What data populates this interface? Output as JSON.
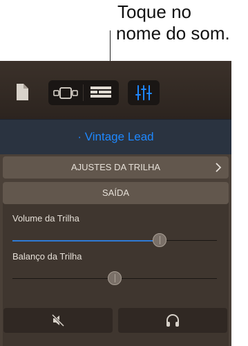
{
  "callout": {
    "line1": "Toque no",
    "line2": "nome do som."
  },
  "toolbar": {
    "icons": [
      "document-icon",
      "view-toggle-icon",
      "tracks-list-icon",
      "mixer-icon"
    ]
  },
  "sound_name": "· Vintage Lead",
  "sections": {
    "track_settings": "AJUSTES DA TRILHA",
    "output": "SAÍDA"
  },
  "sliders": {
    "volume": {
      "label": "Volume da Trilha",
      "value_fraction": 0.72
    },
    "pan": {
      "label": "Balanço da Trilha",
      "value_fraction": 0.5
    }
  },
  "buttons": {
    "icons": [
      "mute-icon",
      "headphones-icon"
    ]
  },
  "colors": {
    "accent": "#1e88ff",
    "panel": "#4a4038",
    "header": "#62574d"
  }
}
